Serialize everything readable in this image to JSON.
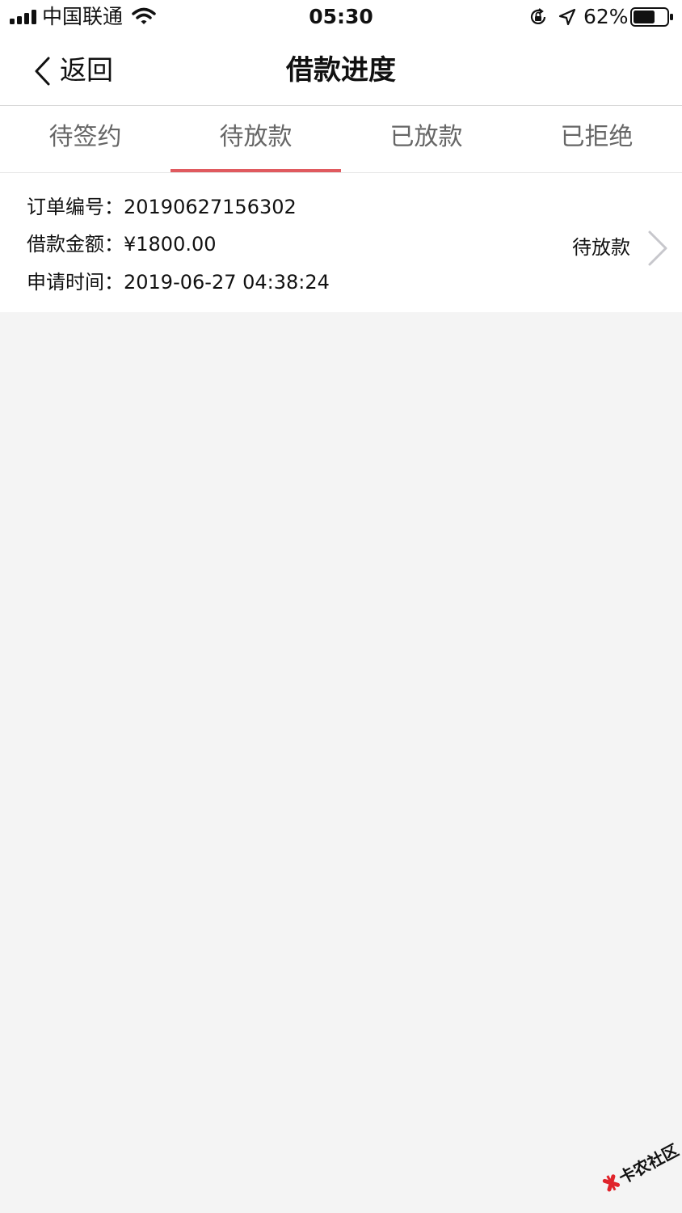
{
  "status_bar": {
    "carrier": "中国联通",
    "time": "05:30",
    "battery": "62%"
  },
  "nav": {
    "back_label": "返回",
    "title": "借款进度"
  },
  "tabs": [
    {
      "label": "待签约",
      "active": false
    },
    {
      "label": "待放款",
      "active": true
    },
    {
      "label": "已放款",
      "active": false
    },
    {
      "label": "已拒绝",
      "active": false
    }
  ],
  "order": {
    "order_no_label": "订单编号：",
    "order_no": "20190627156302",
    "amount_label": "借款金额：",
    "amount": "¥1800.00",
    "apply_time_label": "申请时间：",
    "apply_time": "2019-06-27 04:38:24",
    "status": "待放款"
  },
  "watermark": {
    "text": "卡农社区"
  },
  "colors": {
    "accent": "#e05a5f",
    "background": "#f4f4f4",
    "tab_text": "#666666"
  },
  "icons": [
    "signal-icon",
    "wifi-icon",
    "orientation-lock-icon",
    "location-arrow-icon",
    "battery-icon",
    "back-chevron-icon",
    "chevron-right-icon",
    "watermark-logo"
  ]
}
